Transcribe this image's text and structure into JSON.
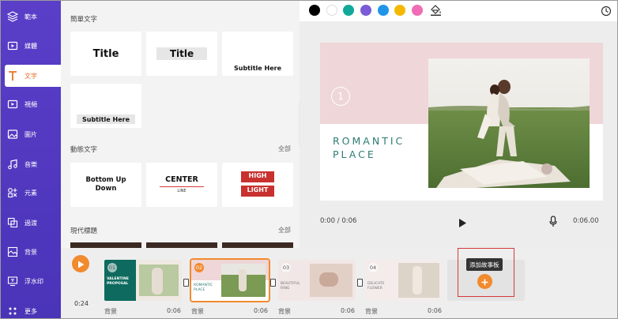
{
  "sidebar": {
    "items": [
      {
        "label": "範本",
        "icon": "layers-icon"
      },
      {
        "label": "媒體",
        "icon": "folder-media-icon"
      },
      {
        "label": "文字",
        "icon": "text-t-icon"
      },
      {
        "label": "視頻",
        "icon": "video-play-icon"
      },
      {
        "label": "圖片",
        "icon": "image-icon"
      },
      {
        "label": "音樂",
        "icon": "music-note-icon"
      },
      {
        "label": "元素",
        "icon": "elements-icon"
      },
      {
        "label": "過渡",
        "icon": "transition-icon"
      },
      {
        "label": "背景",
        "icon": "background-icon"
      },
      {
        "label": "浮水印",
        "icon": "watermark-icon"
      },
      {
        "label": "更多",
        "icon": "more-dots-icon"
      }
    ],
    "active_index": 2,
    "active_color": "#e8702a"
  },
  "panel": {
    "simple_section": "簡單文字",
    "animated_section": "動態文字",
    "modern_section": "現代標題",
    "see_all": "全部",
    "simple_tiles": [
      "Title",
      "Title",
      "Subtitle Here",
      "Subtitle Here"
    ],
    "animated_tiles": {
      "tile1": "Bottom Up Down",
      "tile2_main": "CENTER",
      "tile2_sub": "LINE",
      "tile3_top": "HIGH",
      "tile3_bottom": "LIGHT"
    }
  },
  "colors": {
    "swatches": [
      "#000000",
      "#ffffff",
      "#12a89a",
      "#7b5cd6",
      "#1f95e8",
      "#f5b800",
      "#f06cb4"
    ],
    "accent": "#f28a2e",
    "sidebar": "#5a3ec8"
  },
  "preview": {
    "slide_number": "1",
    "headline_line1": "ROMANTIC",
    "headline_line2": "PLACE",
    "current_time": "0:00 / 0:06",
    "total_time": "0:06.00"
  },
  "timeline": {
    "total_duration": "0:24",
    "clips": [
      {
        "num": "01",
        "label": "背景",
        "duration": "0:06",
        "caption": "VALENTINE PROPOSAL"
      },
      {
        "num": "02",
        "label": "背景",
        "duration": "0:06",
        "caption": "ROMANTIC PLACE"
      },
      {
        "num": "03",
        "label": "背景",
        "duration": "0:06",
        "caption": "BEAUTIFUL RING"
      },
      {
        "num": "04",
        "label": "背景",
        "duration": "0:06",
        "caption": "DELICATE FLOWER"
      }
    ],
    "add_tooltip": "添加故事板"
  }
}
